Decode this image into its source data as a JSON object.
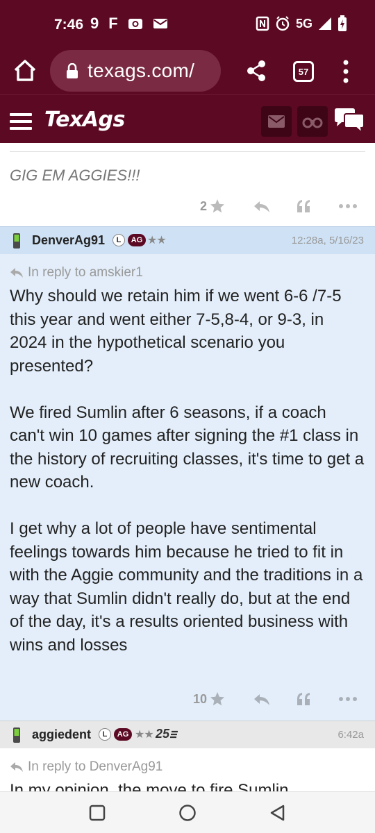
{
  "status_bar": {
    "time": "7:46",
    "network": "5G",
    "left_icons": [
      "9",
      "F",
      "camera-icon",
      "mail-icon"
    ],
    "right_icons": [
      "nfc-icon",
      "alarm-icon",
      "signal-icon",
      "battery-icon"
    ]
  },
  "browser": {
    "url": "texags.com/",
    "tab_count": "57"
  },
  "site": {
    "logo": "TexAgs"
  },
  "top_post": {
    "signature": "GIG EM AGGIES!!!",
    "star_count": "2"
  },
  "posts": [
    {
      "username": "DenverAg91",
      "badge_l": "L",
      "badge_ag": "AG",
      "stars": "★★",
      "timestamp": "12:28a, 5/16/23",
      "reply_to": "In reply to amskier1",
      "body": "Why should we retain him if we went 6-6 /7-5 this year and went either 7-5,8-4, or 9-3, in 2024 in the hypothetical scenario you presented?\n\nWe fired Sumlin after 6 seasons, if a coach can't win 10 games after signing the #1 class in the history of recruiting classes, it's time to get a new coach.\n\nI get why a lot of people have sentimental feelings towards him because he tried to fit in with the Aggie community and the traditions in a way that Sumlin didn't really do, but at the end of the day, it's a results oriented business with wins and losses",
      "star_count": "10"
    },
    {
      "username": "aggiedent",
      "badge_l": "L",
      "badge_ag": "AG",
      "stars": "★★",
      "years_badge": "25",
      "timestamp": "6:42a",
      "reply_to": "In reply to DenverAg91",
      "body_partial": "In my opinion, the move to fire Sumlin"
    }
  ],
  "colors": {
    "maroon": "#5c0a24",
    "post_blue": "#e3eefa",
    "header_blue": "#cfe2f5"
  }
}
